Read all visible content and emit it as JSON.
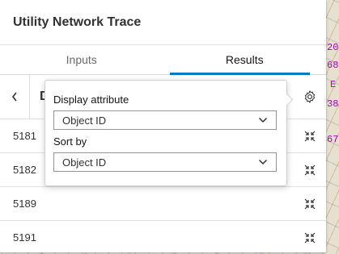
{
  "panel": {
    "title": "Utility Network Trace",
    "tabs": [
      {
        "label": "Inputs",
        "active": false
      },
      {
        "label": "Results",
        "active": true
      }
    ],
    "accent": "#007ac2"
  },
  "toolbar": {
    "title_partial": "D",
    "back_icon": "chevron-left-icon",
    "settings_icon": "gear-icon"
  },
  "results": [
    {
      "id": "5181"
    },
    {
      "id": "5182"
    },
    {
      "id": "5189"
    },
    {
      "id": "5191"
    }
  ],
  "popover": {
    "display_attribute_label": "Display attribute",
    "display_attribute_value": "Object ID",
    "sort_by_label": "Sort by",
    "sort_by_value": "Object ID"
  },
  "map": {
    "marker_color": "#c000c0",
    "edge_labels": [
      "20",
      "68",
      "E",
      "38",
      "67"
    ]
  }
}
